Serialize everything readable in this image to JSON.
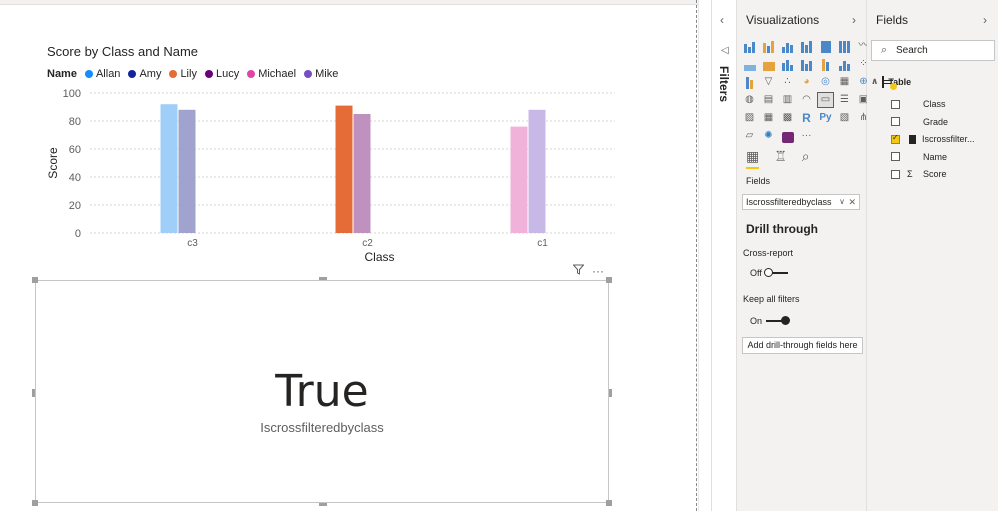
{
  "chart": {
    "title": "Score by Class and Name",
    "legend_title": "Name",
    "legend": [
      {
        "name": "Allan",
        "color": "#118DFF"
      },
      {
        "name": "Amy",
        "color": "#12239E"
      },
      {
        "name": "Lily",
        "color": "#E66C37"
      },
      {
        "name": "Lucy",
        "color": "#6B007B"
      },
      {
        "name": "Michael",
        "color": "#E044A7"
      },
      {
        "name": "Mike",
        "color": "#744EC2"
      }
    ]
  },
  "chart_data": {
    "type": "bar",
    "title": "Score by Class and Name",
    "xlabel": "Class",
    "ylabel": "Score",
    "ylim": [
      0,
      100
    ],
    "yticks": [
      0,
      20,
      40,
      60,
      80,
      100
    ],
    "categories": [
      "c3",
      "c2",
      "c1"
    ],
    "grid": true,
    "legend_position": "top-left",
    "bars": [
      {
        "category": "c3",
        "name": "Allan",
        "value": 92,
        "color": "#9FCFF8"
      },
      {
        "category": "c3",
        "name": "Amy",
        "value": 88,
        "color": "#9FA3CE"
      },
      {
        "category": "c2",
        "name": "Lily",
        "value": 91,
        "color": "#E66C37"
      },
      {
        "category": "c2",
        "name": "Lucy",
        "value": 85,
        "color": "#BF91BF"
      },
      {
        "category": "c1",
        "name": "Michael",
        "value": 76,
        "color": "#F1B2DA"
      },
      {
        "category": "c1",
        "name": "Mike",
        "value": 88,
        "color": "#C8B8E8"
      }
    ]
  },
  "card": {
    "value": "True",
    "label": "Iscrossfilteredbyclass"
  },
  "filters_pane": {
    "label": "Filters"
  },
  "visualizations": {
    "title": "Visualizations",
    "fields_label": "Fields",
    "field_well_value": "Iscrossfilteredbyclass",
    "drill_through_title": "Drill through",
    "cross_report_label": "Cross-report",
    "cross_report_state": "Off",
    "keep_filters_label": "Keep all filters",
    "keep_filters_state": "On",
    "add_drill_label": "Add drill-through fields here",
    "r_icon": "R",
    "py_icon": "Py",
    "more_icon": "···"
  },
  "fields": {
    "title": "Fields",
    "search_placeholder": "Search",
    "table_name": "Table",
    "items": [
      {
        "name": "Class",
        "checked": false,
        "type": ""
      },
      {
        "name": "Grade",
        "checked": false,
        "type": ""
      },
      {
        "name": "Iscrossfilter...",
        "checked": true,
        "type": "calc"
      },
      {
        "name": "Name",
        "checked": false,
        "type": ""
      },
      {
        "name": "Score",
        "checked": false,
        "type": "Σ"
      }
    ]
  },
  "colors": {
    "accent": "#F2C811"
  }
}
